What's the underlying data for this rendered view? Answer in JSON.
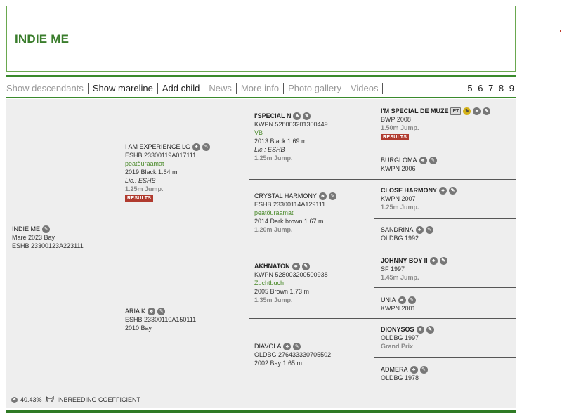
{
  "page": {
    "title": "INDIE ME"
  },
  "tabs": [
    {
      "label": "Show descendants",
      "active": false
    },
    {
      "label": "Show mareline",
      "active": true
    },
    {
      "label": "Add child",
      "active": true
    },
    {
      "label": "News",
      "active": false
    },
    {
      "label": "More info",
      "active": false
    },
    {
      "label": "Photo gallery",
      "active": false
    },
    {
      "label": "Videos",
      "active": false
    }
  ],
  "pages": "5 6 7 8 9",
  "subject": {
    "name": "INDIE ME",
    "line1": "Mare 2023 Bay",
    "line2": "ESHB 23300123A223111"
  },
  "sire": {
    "name": "I AM EXPERIENCE LG",
    "reg": "ESHB 23300119A017111",
    "studbook": "peatõuraamat",
    "info": "2019 Black 1.64 m",
    "lic": "Lic.: ESHB",
    "jump": "1.25m Jump.",
    "results": "RESULTS"
  },
  "dam": {
    "name": "ARIA K",
    "reg": "ESHB 23300110A150111",
    "info": "2010 Bay"
  },
  "ss": {
    "name": "I'SPECIAL N",
    "reg": "KWPN 528003201300449",
    "studbook": "VB",
    "info": "2013 Black 1.69 m",
    "lic": "Lic.: ESHB",
    "jump": "1.25m Jump."
  },
  "sd": {
    "name": "CRYSTAL HARMONY",
    "reg": "ESHB 23300114A129111",
    "studbook": "peatõuraamat",
    "info": "2014 Dark brown 1.67 m",
    "jump": "1.20m Jump."
  },
  "ds": {
    "name": "AKHNATON",
    "reg": "KWPN 528003200500938",
    "studbook": "Zuchtbuch",
    "info": "2005 Brown 1.73 m",
    "jump": "1.35m Jump."
  },
  "dd": {
    "name": "DIAVOLA",
    "reg": "OLDBG 276433330705502",
    "info": "2002 Bay 1.65 m"
  },
  "g3": [
    {
      "name": "I'M SPECIAL DE MUZE",
      "et": "ET",
      "line1": "BWP 2008",
      "extra": "1.50m Jump.",
      "results": "RESULTS"
    },
    {
      "name": "BURGLOMA",
      "line1": "KWPN 2006"
    },
    {
      "name": "CLOSE HARMONY",
      "line1": "KWPN 2007",
      "extra": "1.25m Jump."
    },
    {
      "name": "SANDRINA",
      "line1": "OLDBG 1992"
    },
    {
      "name": "JOHNNY BOY II",
      "line1": "SF 1997",
      "extra": "1.45m Jump."
    },
    {
      "name": "UNIA",
      "line1": "KWPN 2001"
    },
    {
      "name": "DIONYSOS",
      "line1": "OLDBG 1997",
      "extra": "Grand Prix"
    },
    {
      "name": "ADMERA",
      "line1": "OLDBG 1978"
    }
  ],
  "inbreeding": {
    "value": "40.43%",
    "label": "INBREEDING COEFFICIENT"
  },
  "icons": {
    "family": "family-tree-icon",
    "edit": "pencil-icon",
    "gold": "gold-medal-icon"
  }
}
